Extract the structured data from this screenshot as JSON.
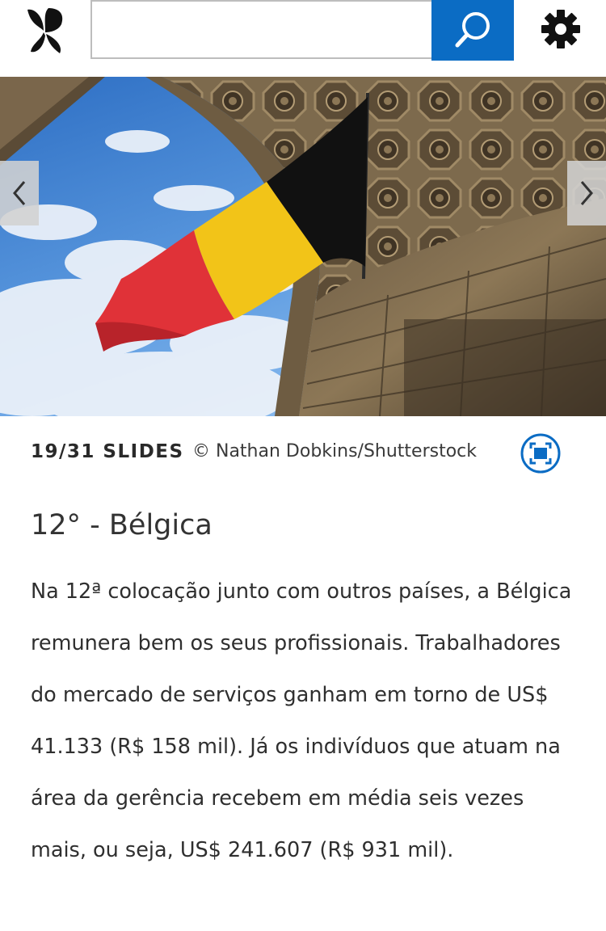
{
  "header": {
    "logo_icon": "butterfly-logo-icon",
    "search": {
      "value": "",
      "placeholder": "",
      "button_icon": "search-icon"
    },
    "settings_icon": "gear-icon",
    "accent_color": "#0b6cc4"
  },
  "slideshow": {
    "current": 19,
    "total": 31,
    "counter_text": "19/31 SLIDES",
    "credit": "© Nathan Dobkins/Shutterstock",
    "prev_icon": "chevron-left-icon",
    "next_icon": "chevron-right-icon",
    "fullscreen_icon": "fullscreen-icon"
  },
  "article": {
    "title": "12°  - Bélgica",
    "body": "Na 12ª colocação junto com outros países, a Bélgica remunera bem os seus profissionais. Trabalhadores do mercado de serviços ganham em torno de US$ 41.133 (R$ 158 mil). Já os indivíduos que atuam na área da gerência recebem em média seis vezes mais, ou seja, US$ 241.607 (R$ 931 mil)."
  }
}
